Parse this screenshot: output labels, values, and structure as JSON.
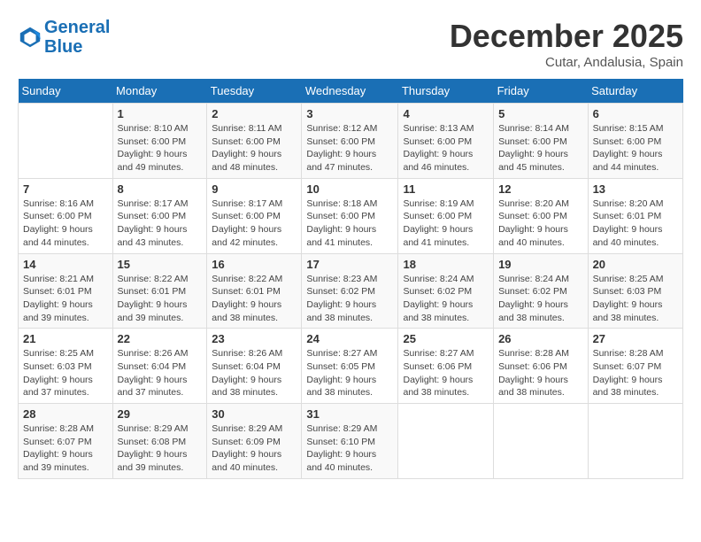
{
  "header": {
    "logo_line1": "General",
    "logo_line2": "Blue",
    "month": "December 2025",
    "location": "Cutar, Andalusia, Spain"
  },
  "weekdays": [
    "Sunday",
    "Monday",
    "Tuesday",
    "Wednesday",
    "Thursday",
    "Friday",
    "Saturday"
  ],
  "weeks": [
    [
      {
        "day": "",
        "sunrise": "",
        "sunset": "",
        "daylight": ""
      },
      {
        "day": "1",
        "sunrise": "8:10 AM",
        "sunset": "6:00 PM",
        "daylight": "9 hours and 49 minutes."
      },
      {
        "day": "2",
        "sunrise": "8:11 AM",
        "sunset": "6:00 PM",
        "daylight": "9 hours and 48 minutes."
      },
      {
        "day": "3",
        "sunrise": "8:12 AM",
        "sunset": "6:00 PM",
        "daylight": "9 hours and 47 minutes."
      },
      {
        "day": "4",
        "sunrise": "8:13 AM",
        "sunset": "6:00 PM",
        "daylight": "9 hours and 46 minutes."
      },
      {
        "day": "5",
        "sunrise": "8:14 AM",
        "sunset": "6:00 PM",
        "daylight": "9 hours and 45 minutes."
      },
      {
        "day": "6",
        "sunrise": "8:15 AM",
        "sunset": "6:00 PM",
        "daylight": "9 hours and 44 minutes."
      }
    ],
    [
      {
        "day": "7",
        "sunrise": "8:16 AM",
        "sunset": "6:00 PM",
        "daylight": "9 hours and 44 minutes."
      },
      {
        "day": "8",
        "sunrise": "8:17 AM",
        "sunset": "6:00 PM",
        "daylight": "9 hours and 43 minutes."
      },
      {
        "day": "9",
        "sunrise": "8:17 AM",
        "sunset": "6:00 PM",
        "daylight": "9 hours and 42 minutes."
      },
      {
        "day": "10",
        "sunrise": "8:18 AM",
        "sunset": "6:00 PM",
        "daylight": "9 hours and 41 minutes."
      },
      {
        "day": "11",
        "sunrise": "8:19 AM",
        "sunset": "6:00 PM",
        "daylight": "9 hours and 41 minutes."
      },
      {
        "day": "12",
        "sunrise": "8:20 AM",
        "sunset": "6:00 PM",
        "daylight": "9 hours and 40 minutes."
      },
      {
        "day": "13",
        "sunrise": "8:20 AM",
        "sunset": "6:01 PM",
        "daylight": "9 hours and 40 minutes."
      }
    ],
    [
      {
        "day": "14",
        "sunrise": "8:21 AM",
        "sunset": "6:01 PM",
        "daylight": "9 hours and 39 minutes."
      },
      {
        "day": "15",
        "sunrise": "8:22 AM",
        "sunset": "6:01 PM",
        "daylight": "9 hours and 39 minutes."
      },
      {
        "day": "16",
        "sunrise": "8:22 AM",
        "sunset": "6:01 PM",
        "daylight": "9 hours and 38 minutes."
      },
      {
        "day": "17",
        "sunrise": "8:23 AM",
        "sunset": "6:02 PM",
        "daylight": "9 hours and 38 minutes."
      },
      {
        "day": "18",
        "sunrise": "8:24 AM",
        "sunset": "6:02 PM",
        "daylight": "9 hours and 38 minutes."
      },
      {
        "day": "19",
        "sunrise": "8:24 AM",
        "sunset": "6:02 PM",
        "daylight": "9 hours and 38 minutes."
      },
      {
        "day": "20",
        "sunrise": "8:25 AM",
        "sunset": "6:03 PM",
        "daylight": "9 hours and 38 minutes."
      }
    ],
    [
      {
        "day": "21",
        "sunrise": "8:25 AM",
        "sunset": "6:03 PM",
        "daylight": "9 hours and 37 minutes."
      },
      {
        "day": "22",
        "sunrise": "8:26 AM",
        "sunset": "6:04 PM",
        "daylight": "9 hours and 37 minutes."
      },
      {
        "day": "23",
        "sunrise": "8:26 AM",
        "sunset": "6:04 PM",
        "daylight": "9 hours and 38 minutes."
      },
      {
        "day": "24",
        "sunrise": "8:27 AM",
        "sunset": "6:05 PM",
        "daylight": "9 hours and 38 minutes."
      },
      {
        "day": "25",
        "sunrise": "8:27 AM",
        "sunset": "6:06 PM",
        "daylight": "9 hours and 38 minutes."
      },
      {
        "day": "26",
        "sunrise": "8:28 AM",
        "sunset": "6:06 PM",
        "daylight": "9 hours and 38 minutes."
      },
      {
        "day": "27",
        "sunrise": "8:28 AM",
        "sunset": "6:07 PM",
        "daylight": "9 hours and 38 minutes."
      }
    ],
    [
      {
        "day": "28",
        "sunrise": "8:28 AM",
        "sunset": "6:07 PM",
        "daylight": "9 hours and 39 minutes."
      },
      {
        "day": "29",
        "sunrise": "8:29 AM",
        "sunset": "6:08 PM",
        "daylight": "9 hours and 39 minutes."
      },
      {
        "day": "30",
        "sunrise": "8:29 AM",
        "sunset": "6:09 PM",
        "daylight": "9 hours and 40 minutes."
      },
      {
        "day": "31",
        "sunrise": "8:29 AM",
        "sunset": "6:10 PM",
        "daylight": "9 hours and 40 minutes."
      },
      {
        "day": "",
        "sunrise": "",
        "sunset": "",
        "daylight": ""
      },
      {
        "day": "",
        "sunrise": "",
        "sunset": "",
        "daylight": ""
      },
      {
        "day": "",
        "sunrise": "",
        "sunset": "",
        "daylight": ""
      }
    ]
  ]
}
